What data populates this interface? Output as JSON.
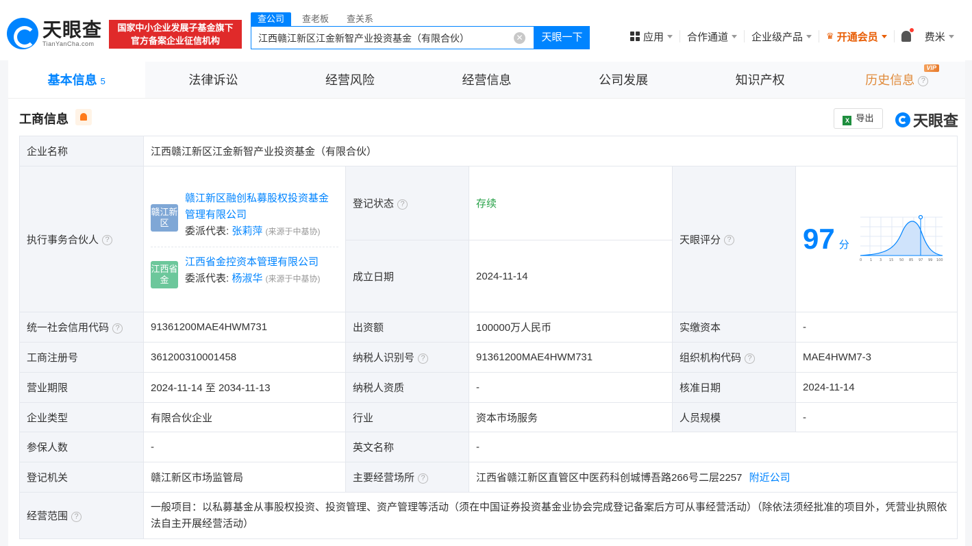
{
  "header": {
    "logo_cn": "天眼查",
    "logo_en": "TianYanCha.com",
    "gov_line1": "国家中小企业发展子基金旗下",
    "gov_line2": "官方备案企业征信机构",
    "search_tabs": [
      "查公司",
      "查老板",
      "查关系"
    ],
    "search_value": "江西赣江新区江金新智产业投资基金（有限合伙）",
    "search_button": "天眼一下",
    "nav": {
      "apps": "应用",
      "channel": "合作通道",
      "enterprise": "企业级产品",
      "vip": "开通会员",
      "user": "费米"
    }
  },
  "tabs": [
    {
      "label": "基本信息",
      "count": "5"
    },
    {
      "label": "法律诉讼"
    },
    {
      "label": "经营风险"
    },
    {
      "label": "经营信息"
    },
    {
      "label": "公司发展"
    },
    {
      "label": "知识产权"
    },
    {
      "label": "历史信息",
      "tag": "VIP"
    }
  ],
  "section": {
    "title": "工商信息",
    "export": "导出",
    "watermark": "天眼查"
  },
  "info": {
    "company_name_label": "企业名称",
    "company_name": "江西赣江新区江金新智产业投资基金（有限合伙）",
    "partner_label": "执行事务合伙人",
    "partners": [
      {
        "badge": "赣江新区",
        "name": "赣江新区融创私募股权投资基金管理有限公司",
        "rep_label": "委派代表:",
        "rep": "张莉萍",
        "src": "(来源于中基协)"
      },
      {
        "badge": "江西省金",
        "name": "江西省金控资本管理有限公司",
        "rep_label": "委派代表:",
        "rep": "杨淑华",
        "src": "(来源于中基协)"
      }
    ],
    "reg_status_label": "登记状态",
    "reg_status": "存续",
    "found_date_label": "成立日期",
    "found_date": "2024-11-14",
    "score_label": "天眼评分",
    "score": "97",
    "score_unit": "分",
    "score_axis": [
      "0",
      "1",
      "3",
      "15",
      "50",
      "85",
      "97",
      "99",
      "100"
    ],
    "credit_code_label": "统一社会信用代码",
    "credit_code": "91361200MAE4HWM731",
    "capital_label": "出资额",
    "capital": "100000万人民币",
    "paid_label": "实缴资本",
    "paid": "-",
    "reg_no_label": "工商注册号",
    "reg_no": "361200310001458",
    "tax_id_label": "纳税人识别号",
    "tax_id": "91361200MAE4HWM731",
    "org_code_label": "组织机构代码",
    "org_code": "MAE4HWM7-3",
    "term_label": "营业期限",
    "term": "2024-11-14 至 2034-11-13",
    "taxpayer_label": "纳税人资质",
    "taxpayer": "-",
    "approve_label": "核准日期",
    "approve": "2024-11-14",
    "type_label": "企业类型",
    "type": "有限合伙企业",
    "industry_label": "行业",
    "industry": "资本市场服务",
    "staff_label": "人员规模",
    "staff": "-",
    "insured_label": "参保人数",
    "insured": "-",
    "en_name_label": "英文名称",
    "en_name": "-",
    "authority_label": "登记机关",
    "authority": "赣江新区市场监管局",
    "address_label": "主要经营场所",
    "address": "江西省赣江新区直管区中医药科创城博吾路266号二层2257",
    "nearby": "附近公司",
    "scope_label": "经营范围",
    "scope": "一般项目：以私募基金从事股权投资、投资管理、资产管理等活动（须在中国证券投资基金业协会完成登记备案后方可从事经营活动）（除依法须经批准的项目外，凭营业执照依法自主开展经营活动）"
  }
}
